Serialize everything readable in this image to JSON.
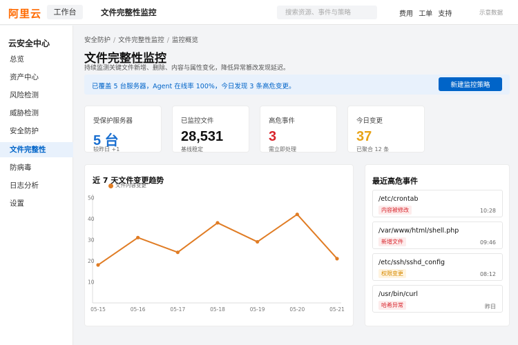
{
  "header": {
    "logo": "阿里云",
    "workbench": "工作台",
    "app_title": "文件完整性监控",
    "search_placeholder": "搜索资源、事件与策略",
    "links": [
      "费用",
      "工单",
      "支持"
    ],
    "demo": "示意数据"
  },
  "sidebar": {
    "title": "云安全中心",
    "items": [
      {
        "label": "总览"
      },
      {
        "label": "资产中心"
      },
      {
        "label": "风险检测"
      },
      {
        "label": "威胁检测"
      },
      {
        "label": "安全防护"
      },
      {
        "label": "文件完整性",
        "active": true
      },
      {
        "label": "防病毒"
      },
      {
        "label": "日志分析"
      },
      {
        "label": "设置"
      }
    ]
  },
  "breadcrumb": [
    "安全防护",
    "文件完整性监控",
    "监控概览"
  ],
  "page": {
    "title": "文件完整性监控",
    "description": "持续监测关键文件新增、删除、内容与属性变化，降低异常篡改发现延迟。"
  },
  "notice": {
    "text": "已覆盖 5 台服务器，Agent 在线率 100%，今日发现 3 条高危变更。",
    "button": "新建监控策略"
  },
  "stats": [
    {
      "label": "受保护服务器",
      "value": "5 台",
      "sub": "较昨日 +1",
      "color": "#1a6fd0"
    },
    {
      "label": "已监控文件",
      "value": "28,531",
      "sub": "基线稳定",
      "color": "#111111"
    },
    {
      "label": "高危事件",
      "value": "3",
      "sub": "需立即处理",
      "color": "#d8242b"
    },
    {
      "label": "今日变更",
      "value": "37",
      "sub": "已聚合 12 条",
      "color": "#e8a317"
    }
  ],
  "chart_data": {
    "type": "line",
    "title": "近 7 天文件变更趋势",
    "categories": [
      "05-15",
      "05-16",
      "05-17",
      "05-18",
      "05-19",
      "05-20",
      "05-21"
    ],
    "series": [
      {
        "name": "文件内容变更",
        "values": [
          18,
          31,
          24,
          38,
          29,
          42,
          21
        ],
        "color": "#e07c24"
      }
    ],
    "yticks": [
      10,
      20,
      30,
      40,
      50
    ],
    "ylim": [
      0,
      55
    ],
    "grid": false,
    "legend": "top-left"
  },
  "events": {
    "title": "最近高危事件",
    "items": [
      {
        "path": "/etc/crontab",
        "tag": "内容被修改",
        "tag_style": "red",
        "time": "10:28"
      },
      {
        "path": "/var/www/html/shell.php",
        "tag": "新增文件",
        "tag_style": "red",
        "time": "09:46"
      },
      {
        "path": "/etc/ssh/sshd_config",
        "tag": "权限变更",
        "tag_style": "amber",
        "time": "08:12"
      },
      {
        "path": "/usr/bin/curl",
        "tag": "哈希异常",
        "tag_style": "red",
        "time": "昨日"
      }
    ]
  }
}
